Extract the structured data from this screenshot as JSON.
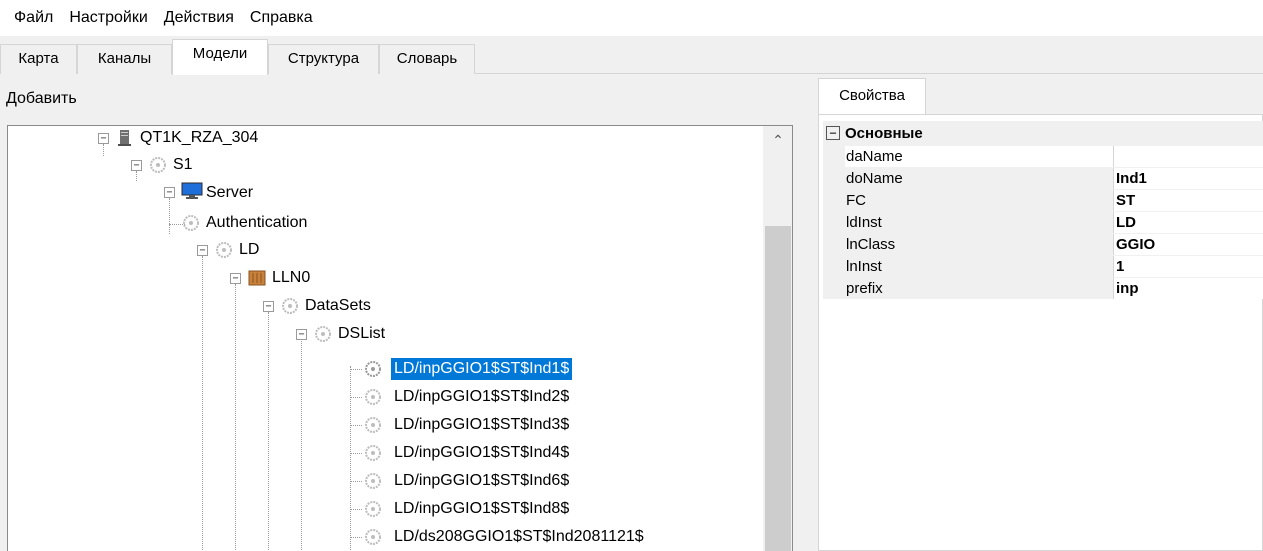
{
  "menu": [
    "Файл",
    "Настройки",
    "Действия",
    "Справка"
  ],
  "tabs": [
    {
      "label": "Карта",
      "active": false
    },
    {
      "label": "Каналы",
      "active": false
    },
    {
      "label": "Модели",
      "active": true
    },
    {
      "label": "Структура",
      "active": false
    },
    {
      "label": "Словарь",
      "active": false
    }
  ],
  "left_panel": {
    "add_label": "Добавить"
  },
  "tree": {
    "nodes": [
      {
        "label": "QT1K_RZA_304",
        "icon": "device-icon",
        "expanded": true
      },
      {
        "label": "S1",
        "icon": "network-icon",
        "expanded": true
      },
      {
        "label": "Server",
        "icon": "monitor-icon",
        "expanded": true
      },
      {
        "label": "Authentication",
        "icon": "network-icon"
      },
      {
        "label": "LD",
        "icon": "network-icon",
        "expanded": true
      },
      {
        "label": "LLN0",
        "icon": "logical-node-icon",
        "expanded": true
      },
      {
        "label": "DataSets",
        "icon": "network-icon",
        "expanded": true
      },
      {
        "label": "DSList",
        "icon": "network-icon",
        "expanded": true
      },
      {
        "label": "LD/inpGGIO1$ST$Ind1$",
        "icon": "network-icon",
        "selected": true
      },
      {
        "label": "LD/inpGGIO1$ST$Ind2$",
        "icon": "network-icon"
      },
      {
        "label": "LD/inpGGIO1$ST$Ind3$",
        "icon": "network-icon"
      },
      {
        "label": "LD/inpGGIO1$ST$Ind4$",
        "icon": "network-icon"
      },
      {
        "label": "LD/inpGGIO1$ST$Ind6$",
        "icon": "network-icon"
      },
      {
        "label": "LD/inpGGIO1$ST$Ind8$",
        "icon": "network-icon"
      },
      {
        "label": "LD/ds208GGIO1$ST$Ind2081121$",
        "icon": "network-icon"
      }
    ]
  },
  "properties": {
    "tab_label": "Свойства",
    "category": "Основные",
    "category_toggle": "⊟",
    "rows": [
      {
        "name": "daName",
        "value": ""
      },
      {
        "name": "doName",
        "value": "Ind1"
      },
      {
        "name": "FC",
        "value": "ST"
      },
      {
        "name": "ldInst",
        "value": "LD"
      },
      {
        "name": "lnClass",
        "value": "GGIO"
      },
      {
        "name": "lnInst",
        "value": "1"
      },
      {
        "name": "prefix",
        "value": "inp"
      }
    ]
  },
  "colors": {
    "selection": "#0078d7",
    "panel_bg": "#f0f0f0"
  }
}
